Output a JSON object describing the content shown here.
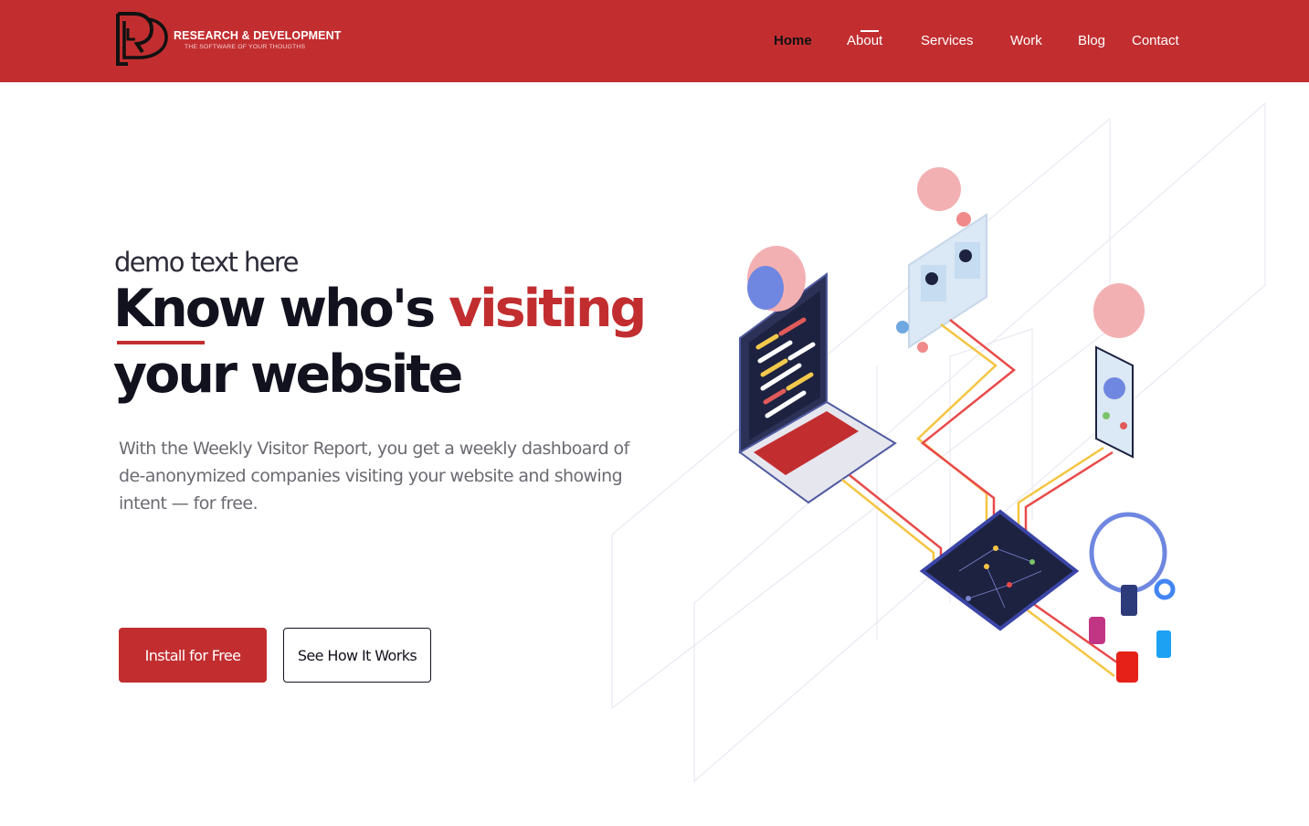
{
  "brand": {
    "name": "RESEARCH & DEVELOPMENT",
    "tagline": "THE SOFTWARE OF YOUR THOUGTHS",
    "colors": {
      "primary": "#c22e30",
      "dark": "#12121f",
      "white": "#ffffff"
    }
  },
  "nav": {
    "items": [
      {
        "label": "Home",
        "active": true
      },
      {
        "label": "About",
        "active": false
      },
      {
        "label": "Services",
        "active": false
      },
      {
        "label": "Work",
        "active": false
      },
      {
        "label": "Blog",
        "active": false
      },
      {
        "label": "Contact",
        "active": false
      }
    ]
  },
  "hero": {
    "kicker": "demo text here",
    "headline_part1": "Know who's ",
    "headline_accent": "visiting",
    "headline_part2": "your website",
    "description": "With the Weekly Visitor Report, you get a weekly dashboard of de-anonymized companies visiting your website and showing intent — for free.",
    "primary_cta": "Install for Free",
    "secondary_cta": "See How It Works"
  },
  "illustration": {
    "icons": [
      "cloud-icon",
      "laptop-code-icon",
      "video-call-icon",
      "phone-contact-icon",
      "chip-network-icon",
      "facebook-icon",
      "google-icon",
      "instagram-icon",
      "twitter-icon",
      "youtube-icon"
    ]
  }
}
